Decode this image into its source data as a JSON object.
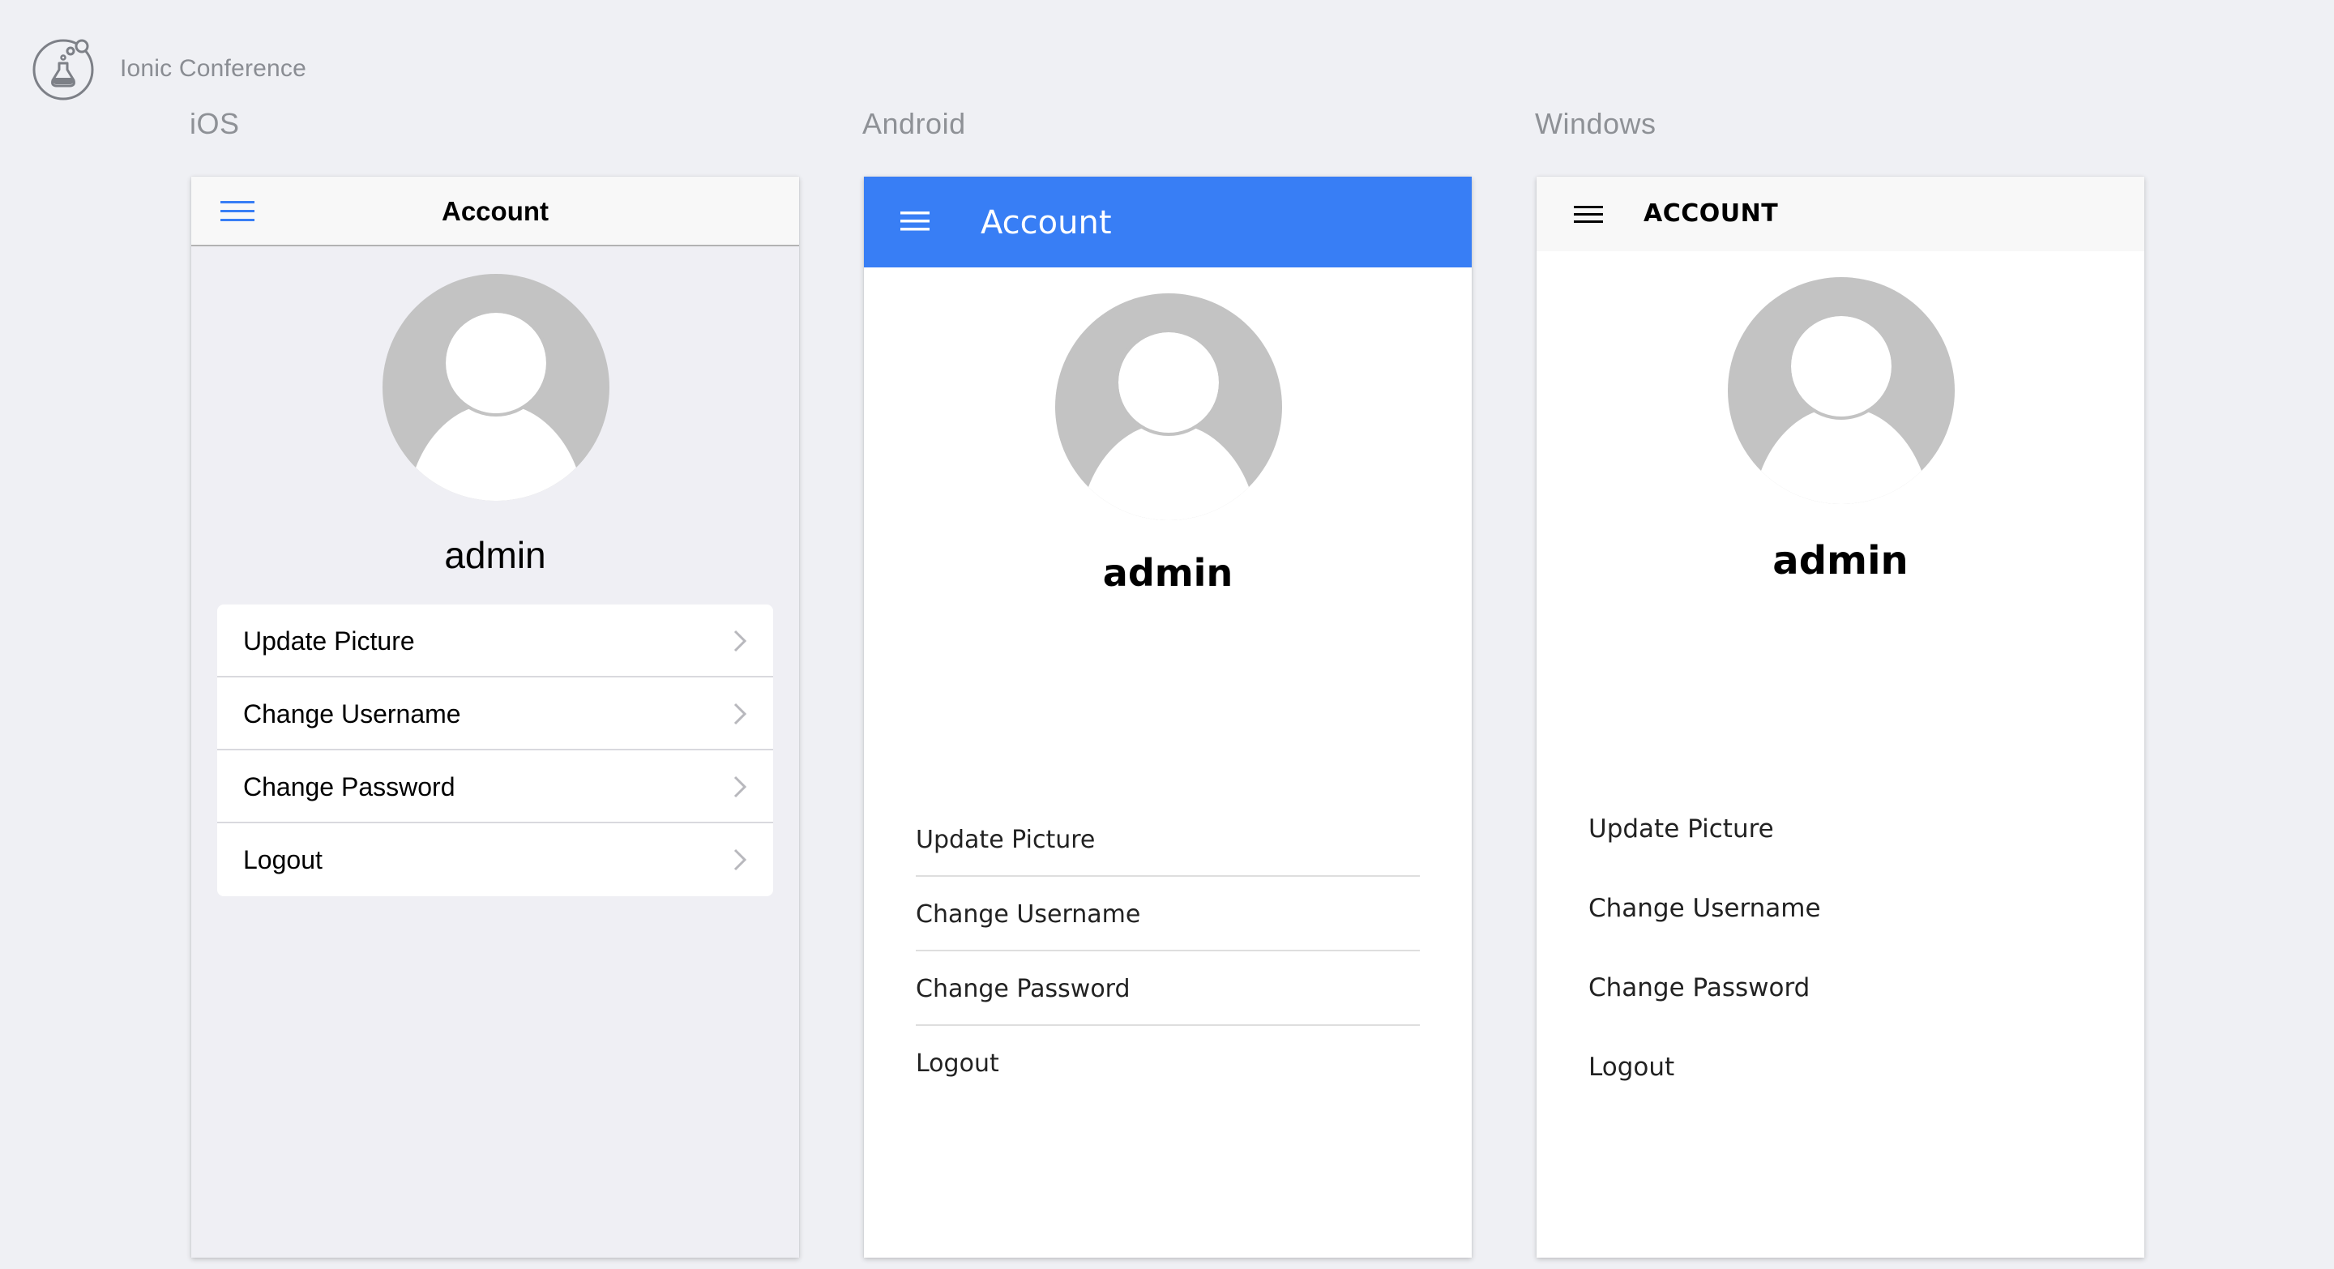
{
  "app": {
    "title": "Ionic Conference",
    "logo_icon": "ionic-flask-logo"
  },
  "colors": {
    "background": "#eff0f4",
    "ios_accent": "#387ef5",
    "android_toolbar": "#387ef5",
    "avatar_gray": "#c3c3c3"
  },
  "platforms": {
    "ios": {
      "label": "iOS",
      "toolbar_title": "Account",
      "username": "admin",
      "menu_icon": "hamburger-menu-icon",
      "items": [
        {
          "label": "Update Picture"
        },
        {
          "label": "Change Username"
        },
        {
          "label": "Change Password"
        },
        {
          "label": "Logout"
        }
      ]
    },
    "android": {
      "label": "Android",
      "toolbar_title": "Account",
      "username": "admin",
      "menu_icon": "hamburger-menu-icon",
      "items": [
        {
          "label": "Update Picture"
        },
        {
          "label": "Change Username"
        },
        {
          "label": "Change Password"
        },
        {
          "label": "Logout"
        }
      ]
    },
    "windows": {
      "label": "Windows",
      "toolbar_title": "ACCOUNT",
      "username": "admin",
      "menu_icon": "hamburger-menu-icon",
      "items": [
        {
          "label": "Update Picture"
        },
        {
          "label": "Change Username"
        },
        {
          "label": "Change Password"
        },
        {
          "label": "Logout"
        }
      ]
    }
  }
}
